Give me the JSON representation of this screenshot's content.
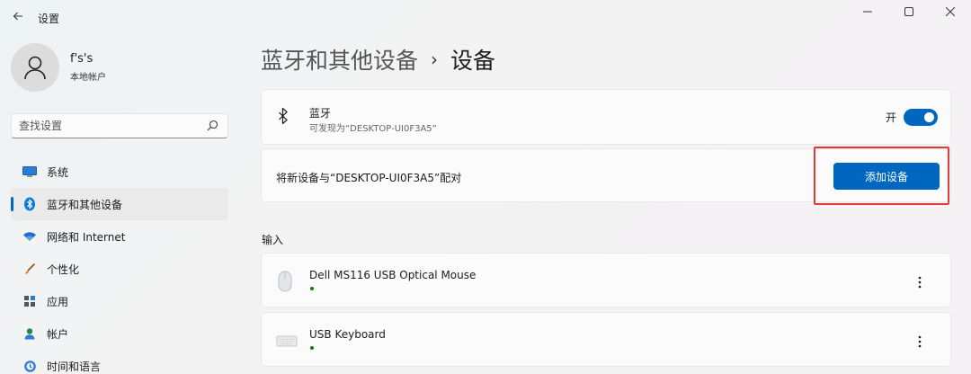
{
  "window": {
    "title": "设置",
    "controls": [
      "minimize-icon",
      "maximize-icon",
      "close-icon"
    ]
  },
  "user": {
    "name": "f's's",
    "account_type": "本地帐户"
  },
  "search": {
    "placeholder": "查找设置"
  },
  "sidebar": {
    "items": [
      {
        "label": "系统",
        "icon": "monitor-icon"
      },
      {
        "label": "蓝牙和其他设备",
        "icon": "bluetooth-icon",
        "active": true
      },
      {
        "label": "网络和 Internet",
        "icon": "wifi-icon"
      },
      {
        "label": "个性化",
        "icon": "brush-icon"
      },
      {
        "label": "应用",
        "icon": "apps-icon"
      },
      {
        "label": "帐户",
        "icon": "person-icon"
      },
      {
        "label": "时间和语言",
        "icon": "globe-clock-icon"
      }
    ]
  },
  "breadcrumb": {
    "parent": "蓝牙和其他设备",
    "separator": "›",
    "current": "设备"
  },
  "bluetooth": {
    "title": "蓝牙",
    "subtitle": "可发现为“DESKTOP-UI0F3A5”",
    "state_label": "开",
    "enabled": true
  },
  "pair": {
    "text": "将新设备与“DESKTOP-UI0F3A5”配对",
    "button_label": "添加设备"
  },
  "input_section": {
    "label": "输入",
    "devices": [
      {
        "name": "Dell MS116 USB Optical Mouse",
        "icon": "mouse-icon",
        "status": "connected"
      },
      {
        "name": "USB Keyboard",
        "icon": "keyboard-icon",
        "status": "connected"
      }
    ]
  },
  "colors": {
    "accent": "#0067c0",
    "highlight": "#e53935",
    "status_connected": "#107c10"
  }
}
